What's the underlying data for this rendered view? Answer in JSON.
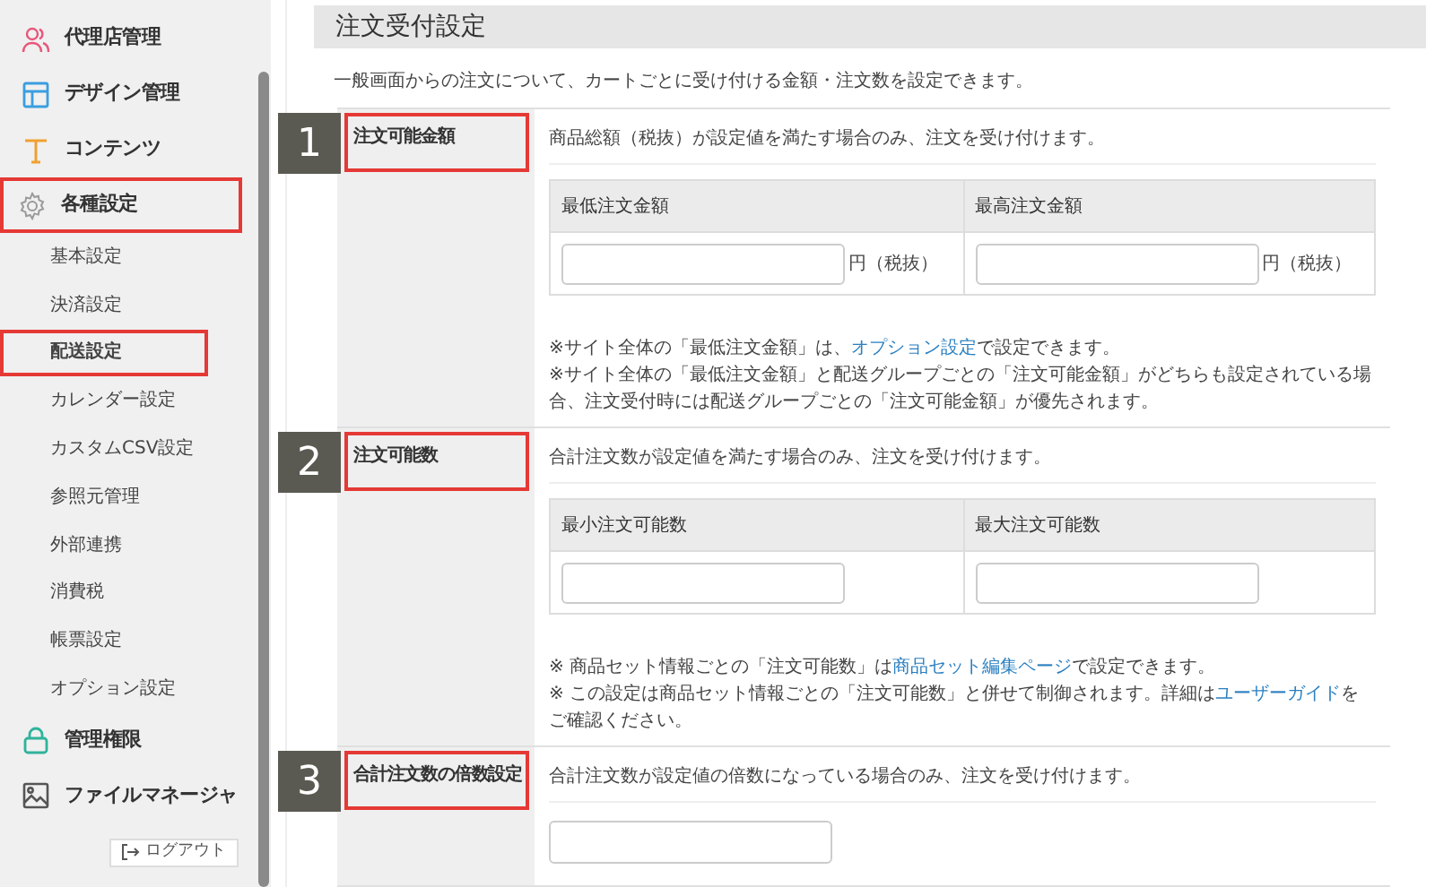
{
  "sidebar": {
    "items": [
      {
        "label": "代理店管理",
        "highlighted": false
      },
      {
        "label": "デザイン管理",
        "highlighted": false
      },
      {
        "label": "コンテンツ",
        "highlighted": false
      },
      {
        "label": "各種設定",
        "highlighted": true,
        "children": [
          {
            "label": "基本設定",
            "selected": false,
            "highlighted": false
          },
          {
            "label": "決済設定",
            "selected": false,
            "highlighted": false
          },
          {
            "label": "配送設定",
            "selected": true,
            "highlighted": true
          },
          {
            "label": "カレンダー設定",
            "selected": false,
            "highlighted": false
          },
          {
            "label": "カスタムCSV設定",
            "selected": false,
            "highlighted": false
          },
          {
            "label": "参照元管理",
            "selected": false,
            "highlighted": false
          },
          {
            "label": "外部連携",
            "selected": false,
            "highlighted": false
          },
          {
            "label": "消費税",
            "selected": false,
            "highlighted": false
          },
          {
            "label": "帳票設定",
            "selected": false,
            "highlighted": false
          },
          {
            "label": "オプション設定",
            "selected": false,
            "highlighted": false
          }
        ]
      },
      {
        "label": "管理権限",
        "highlighted": false
      },
      {
        "label": "ファイルマネージャ",
        "highlighted": false
      }
    ],
    "logout": "ログアウト"
  },
  "page": {
    "title": "注文受付設定",
    "description": "一般画面からの注文について、カートごとに受け付ける金額・注文数を設定できます。",
    "sections": [
      {
        "number": "1",
        "label": "注文可能金額",
        "highlighted": true,
        "description": "商品総額（税抜）が設定値を満たす場合のみ、注文を受け付けます。",
        "kind": "table",
        "columns": [
          {
            "heading": "最低注文金額",
            "suffix": "円（税抜）"
          },
          {
            "heading": "最高注文金額",
            "suffix": "円（税抜）"
          }
        ],
        "notes": [
          [
            {
              "text": "※サイト全体の「最低注文金額」は、"
            },
            {
              "text": "オプション設定",
              "link": true
            },
            {
              "text": "で設定できます。"
            }
          ],
          [
            {
              "text": "※サイト全体の「最低注文金額」と配送グループごとの「注文可能金額」がどちらも設定されている場合、注文受付時には配送グループごとの「注文可能金額」が優先されます。"
            }
          ]
        ]
      },
      {
        "number": "2",
        "label": "注文可能数",
        "highlighted": true,
        "description": "合計注文数が設定値を満たす場合のみ、注文を受け付けます。",
        "kind": "table",
        "columns": [
          {
            "heading": "最小注文可能数"
          },
          {
            "heading": "最大注文可能数"
          }
        ],
        "notes": [
          [
            {
              "text": "※ 商品セット情報ごとの「注文可能数」は"
            },
            {
              "text": "商品セット編集ページ",
              "link": true
            },
            {
              "text": "で設定できます。"
            }
          ],
          [
            {
              "text": "※ この設定は商品セット情報ごとの「注文可能数」と併せて制御されます。詳細は"
            },
            {
              "text": "ユーザーガイド",
              "link": true
            },
            {
              "text": "をご確認ください。"
            }
          ]
        ]
      },
      {
        "number": "3",
        "label": "合計注文数の倍数設定",
        "highlighted": true,
        "description": "合計注文数が設定値の倍数になっている場合のみ、注文を受け付けます。",
        "kind": "single"
      }
    ]
  }
}
